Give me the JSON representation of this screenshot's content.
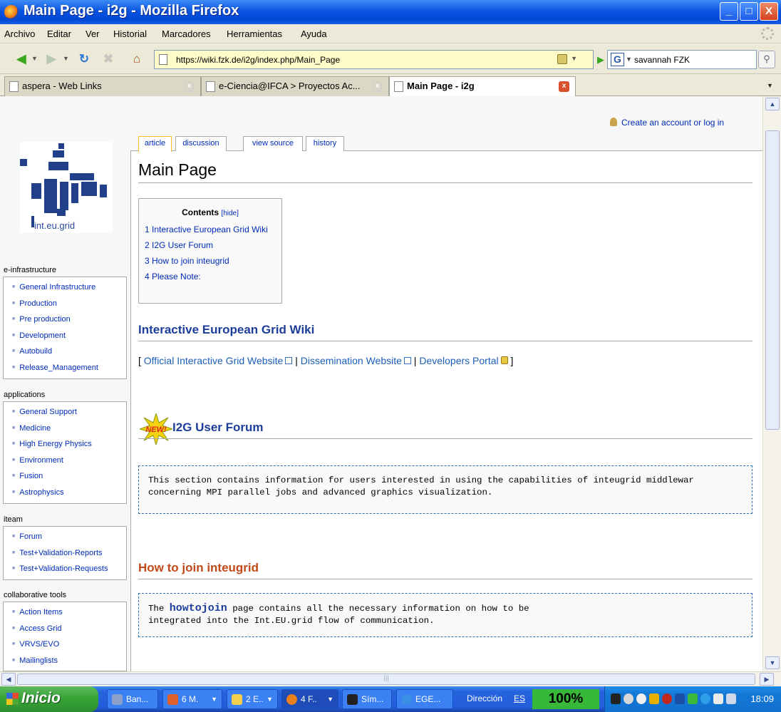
{
  "window": {
    "title": "Main Page - i2g - Mozilla Firefox",
    "minimize": "_",
    "maximize": "□",
    "close": "X"
  },
  "menu": [
    "Archivo",
    "Editar",
    "Ver",
    "Historial",
    "Marcadores",
    "Herramientas",
    "Ayuda"
  ],
  "nav": {
    "url": "https://wiki.fzk.de/i2g/index.php/Main_Page",
    "search_value": "savannah FZK",
    "search_engine": "G"
  },
  "tabs": [
    {
      "label": "aspera - Web Links",
      "active": false
    },
    {
      "label": "e-Ciencia@IFCA > Proyectos Ac...",
      "active": false
    },
    {
      "label": "Main Page - i2g",
      "active": true
    }
  ],
  "page": {
    "personal_link": "Create an account or log in",
    "logo_text": "int.eu.grid",
    "page_tabs": [
      "article",
      "discussion",
      "view source",
      "history"
    ],
    "first_heading": "Main Page",
    "toc": {
      "title": "Contents",
      "hide": "[hide]",
      "items": [
        "1 Interactive European Grid Wiki",
        "2 I2G User Forum",
        "3 How to join inteugrid",
        "4 Please Note:"
      ]
    },
    "sidebar": [
      {
        "header": "e-infrastructure",
        "items": [
          "General Infrastructure",
          "Production",
          "Pre production",
          "Development",
          "Autobuild",
          "Release_Management"
        ]
      },
      {
        "header": "applications",
        "items": [
          "General Support",
          "Medicine",
          "High Energy Physics",
          "Environment",
          "Fusion",
          "Astrophysics"
        ]
      },
      {
        "header": "iteam",
        "items": [
          "Forum",
          "Test+Validation-Reports",
          "Test+Validation-Requests"
        ]
      },
      {
        "header": "collaborative tools",
        "items": [
          "Action Items",
          "Access Grid",
          "VRVS/EVO",
          "Mailinglists"
        ]
      }
    ],
    "section_wiki": {
      "heading": "Interactive European Grid Wiki",
      "open_bracket": "[",
      "link1": "Official Interactive Grid Website",
      "link2": "Dissemination Website",
      "link3": "Developers Portal",
      "sep": "|",
      "close_bracket": "]"
    },
    "section_forum": {
      "badge": "NEW!",
      "heading": "I2G User Forum",
      "line1": "This section contains information for users interested in using the capabilities of inteugrid middlewar",
      "line2": "concerning MPI parallel jobs and advanced graphics visualization."
    },
    "section_join": {
      "heading": "How to join inteugrid",
      "pre": "The ",
      "keyword": "howtojoin",
      "post": " page contains all the necessary information on how to be",
      "line2": "integrated into the Int.EU.grid flow of communication."
    }
  },
  "taskbar": {
    "start": "Inicio",
    "buttons": [
      "Ban...",
      "6 M.",
      "2 E..",
      "4 F..",
      "Sím...",
      "EGE..."
    ],
    "address_label": "Dirección",
    "lang": "ES",
    "zoom": "100%",
    "clock": "18:09"
  },
  "colors": {
    "titlebar": "#0a54e0",
    "link": "#002bb8",
    "heading_blue": "#1c3e9a",
    "heading_red": "#c24a1a",
    "active_tab_border": "#fabd23"
  }
}
